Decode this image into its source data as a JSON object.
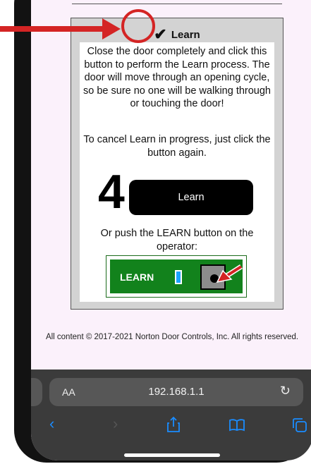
{
  "panel": {
    "check": "✔",
    "title": "Learn",
    "instructions": "Close the door completely and click this button to perform the Learn process. The door will move through an opening cycle, so be sure no one will be walking through or touching the door!",
    "cancel_text": "To cancel Learn in progress, just click the button again.",
    "step_number": "4",
    "learn_button": "Learn",
    "operator_text": "Or push the LEARN button on the operator:",
    "operator_label": "LEARN"
  },
  "footer": "All content © 2017-2021 Norton Door Controls, Inc. All rights reserved.",
  "browser": {
    "text_size": "AA",
    "url": "192.168.1.1",
    "reload": "↻",
    "back": "‹",
    "forward": "›",
    "share": "⎋",
    "bookmarks": "□",
    "tabs": "⧉"
  },
  "colors": {
    "accent_arrow": "#d42424",
    "operator_green": "#12821c",
    "browser_blue": "#1a8cff"
  }
}
